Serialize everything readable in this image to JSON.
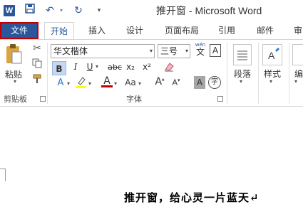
{
  "title": "推开窗 - Microsoft Word",
  "quick_access": {
    "word_icon": "W",
    "save_icon": "save-icon",
    "undo_icon": "undo-icon",
    "redo_icon": "redo-icon"
  },
  "tabs": [
    "文件",
    "开始",
    "插入",
    "设计",
    "页面布局",
    "引用",
    "邮件",
    "审"
  ],
  "clipboard": {
    "paste_label": "粘贴",
    "group_label": "剪贴板"
  },
  "font": {
    "font_name": "华文楷体",
    "font_size": "三号",
    "wen_label": "wén",
    "wen_char": "文",
    "a_box": "A",
    "bold": "B",
    "italic": "I",
    "underline": "U",
    "strike": "abc",
    "subscript": "x₂",
    "superscript": "x²",
    "highlight": "A",
    "font_color": "A",
    "case": "Aa",
    "grow": "A",
    "shrink": "A",
    "char_shading": "A",
    "enclose": "字",
    "group_label": "字体"
  },
  "paragraph": {
    "label": "段落"
  },
  "styles": {
    "label": "样式"
  },
  "edit": {
    "label": "编"
  },
  "document": {
    "line1": "推开窗，给心灵一片蓝天↵"
  },
  "colors": {
    "accent": "#2b579a",
    "highlight": "#ffff00",
    "font_color": "#c00000",
    "file_border": "#c00000"
  }
}
